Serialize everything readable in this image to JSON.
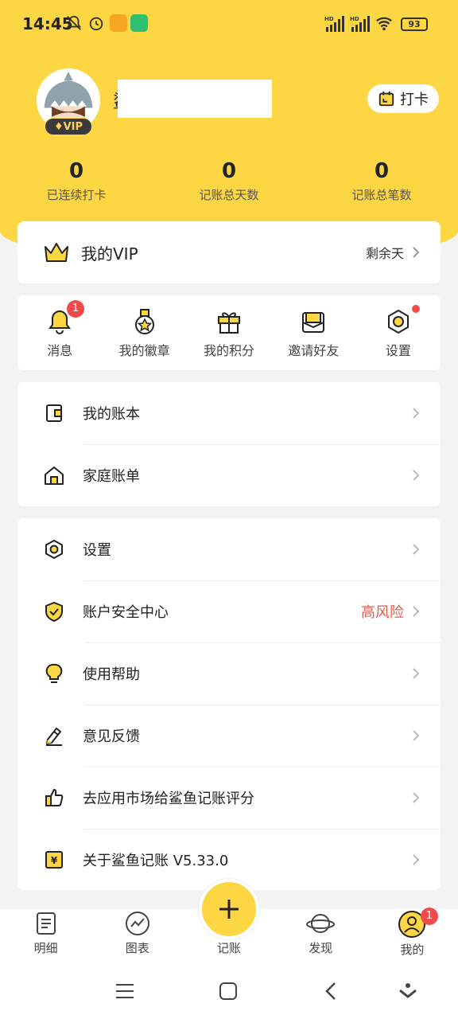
{
  "status_bar": {
    "time": "14:45",
    "battery": "93",
    "network": [
      "HD",
      "HD"
    ]
  },
  "profile": {
    "username_visible": "鲨",
    "vip_label": "VIP",
    "checkin_label": "打卡",
    "stats": [
      {
        "value": "0",
        "label": "已连续打卡"
      },
      {
        "value": "0",
        "label": "记账总天数"
      },
      {
        "value": "0",
        "label": "记账总笔数"
      }
    ]
  },
  "vip_card": {
    "label": "我的VIP",
    "right_text": "剩余天"
  },
  "quick_actions": [
    {
      "label": "消息",
      "icon": "bell-icon",
      "badge": "1"
    },
    {
      "label": "我的徽章",
      "icon": "medal-icon"
    },
    {
      "label": "我的积分",
      "icon": "gift-icon"
    },
    {
      "label": "邀请好友",
      "icon": "envelope-icon"
    },
    {
      "label": "设置",
      "icon": "settings-icon",
      "dot": true
    }
  ],
  "menu_group_1": [
    {
      "label": "我的账本",
      "icon": "wallet-icon"
    },
    {
      "label": "家庭账单",
      "icon": "house-icon"
    }
  ],
  "menu_group_2": [
    {
      "label": "设置",
      "icon": "settings-icon"
    },
    {
      "label": "账户安全中心",
      "icon": "shield-icon",
      "right_text": "高风险"
    },
    {
      "label": "使用帮助",
      "icon": "lightbulb-icon"
    },
    {
      "label": "意见反馈",
      "icon": "pencil-icon"
    },
    {
      "label": "去应用市场给鲨鱼记账评分",
      "icon": "thumbs-up-icon"
    },
    {
      "label": "关于鲨鱼记账 V5.33.0",
      "icon": "yen-icon"
    }
  ],
  "bottom_nav": [
    {
      "label": "明细",
      "icon": "list-icon"
    },
    {
      "label": "图表",
      "icon": "chart-icon"
    },
    {
      "label": "记账",
      "icon": "plus-icon"
    },
    {
      "label": "发现",
      "icon": "planet-icon"
    },
    {
      "label": "我的",
      "icon": "user-icon",
      "badge": "1"
    }
  ],
  "colors": {
    "brand_yellow": "#fdd643",
    "badge_red": "#f04b4b",
    "risk_red": "#e05a4a"
  }
}
